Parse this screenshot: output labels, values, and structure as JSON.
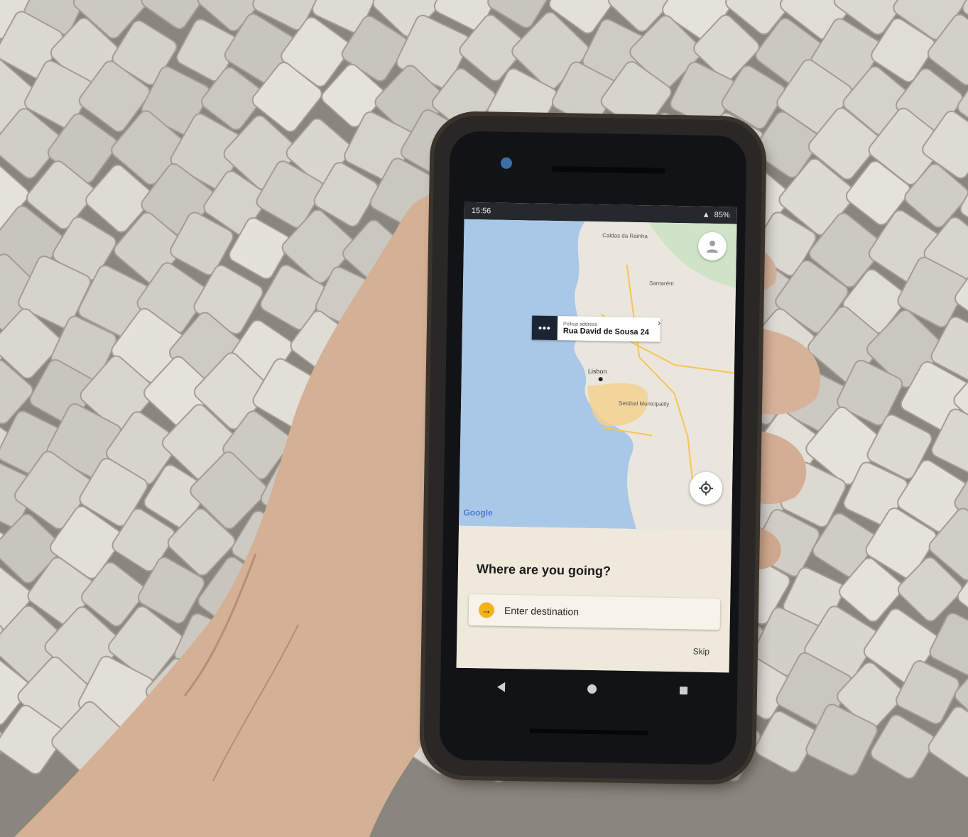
{
  "scene": {
    "description_colors": {
      "pavement": "#c9c4bc",
      "grout": "#8a857d",
      "skin": "#d9b9a0",
      "phone_body": "#2a2826",
      "accent": "#f3b21b"
    }
  },
  "status_bar": {
    "time": "15:56",
    "battery": "85%"
  },
  "map": {
    "labels": [
      "Caldas da Rainha",
      "Santarém",
      "Lisbon",
      "Setúbal Municipality"
    ],
    "google": "Google"
  },
  "pickup": {
    "label": "Pickup address",
    "address": "Rua David de Sousa 24",
    "dots": "•••"
  },
  "sheet": {
    "question": "Where are you going?",
    "destination_placeholder": "Enter destination",
    "skip": "Skip"
  }
}
